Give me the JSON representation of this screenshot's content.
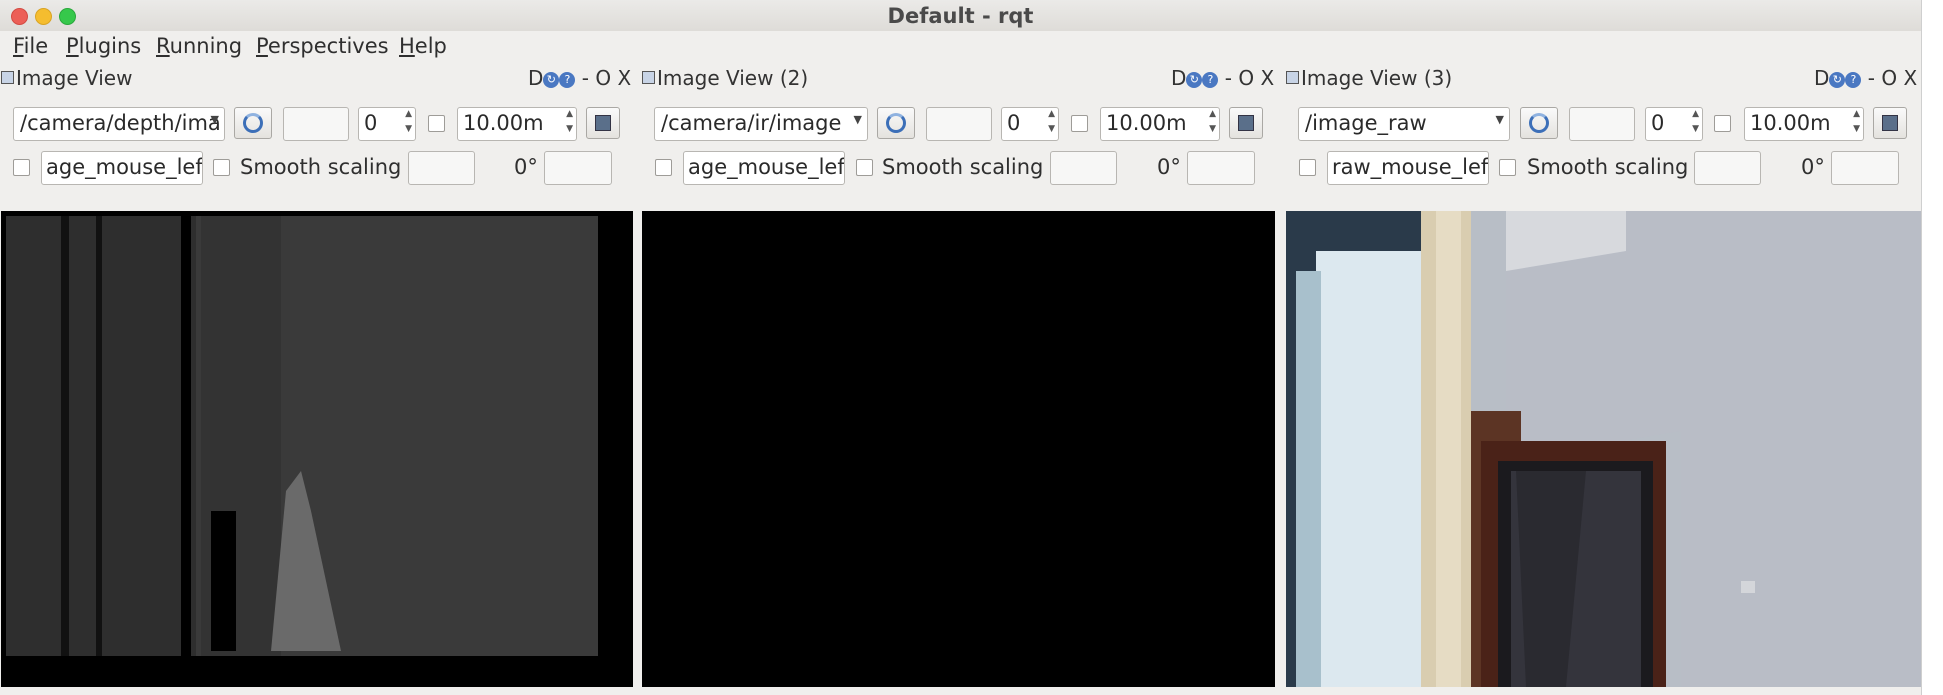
{
  "window": {
    "title": "Default - rqt"
  },
  "menu": [
    {
      "pre": "",
      "u": "F",
      "post": "ile"
    },
    {
      "pre": "",
      "u": "P",
      "post": "lugins"
    },
    {
      "pre": "",
      "u": "R",
      "post": "unning"
    },
    {
      "pre": "",
      "u": "P",
      "post": "erspectives"
    },
    {
      "pre": "",
      "u": "H",
      "post": "elp"
    }
  ],
  "panels": [
    {
      "title": "Image View",
      "topic": "/camera/depth/ima",
      "spin_value": "0",
      "max_value": "10.00m",
      "mouse_topic": "age_mouse_left",
      "smooth_label": "Smooth scaling",
      "rotation": "0°",
      "controls": "D  - O X"
    },
    {
      "title": "Image View (2)",
      "topic": "/camera/ir/image",
      "spin_value": "0",
      "max_value": "10.00m",
      "mouse_topic": "age_mouse_left",
      "smooth_label": "Smooth scaling",
      "rotation": "0°",
      "controls": "D  - O X"
    },
    {
      "title": "Image View (3)",
      "topic": "/image_raw",
      "spin_value": "0",
      "max_value": "10.00m",
      "mouse_topic": "raw_mouse_left",
      "smooth_label": "Smooth scaling",
      "rotation": "0°",
      "controls": "D  - O X"
    }
  ]
}
